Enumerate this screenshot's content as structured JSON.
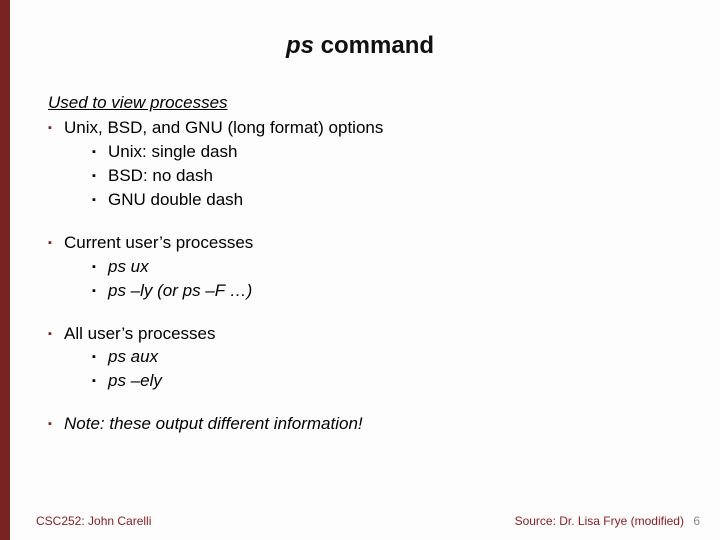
{
  "title": {
    "command": "ps",
    "rest": " command"
  },
  "subtitle": "Used to view processes",
  "sections": [
    {
      "label": "Unix, BSD, and GNU (long format) options",
      "italic": false,
      "items": [
        {
          "text": "Unix: single dash",
          "italic": false
        },
        {
          "text": "BSD: no dash",
          "italic": false
        },
        {
          "text": "GNU double dash",
          "italic": false
        }
      ]
    },
    {
      "label": "Current user’s processes",
      "italic": false,
      "items": [
        {
          "text": "ps ux",
          "italic": true
        },
        {
          "text": "ps –ly   (or ps –F  …)",
          "italic": true
        }
      ]
    },
    {
      "label": "All user’s processes",
      "italic": false,
      "items": [
        {
          "text": "ps aux",
          "italic": true
        },
        {
          "text": "ps –ely",
          "italic": true
        }
      ]
    },
    {
      "label": "Note: these output different information!",
      "italic": true,
      "items": []
    }
  ],
  "footer": {
    "left": "CSC252: John Carelli",
    "right": "Source: Dr. Lisa Frye (modified)",
    "page": "6"
  }
}
